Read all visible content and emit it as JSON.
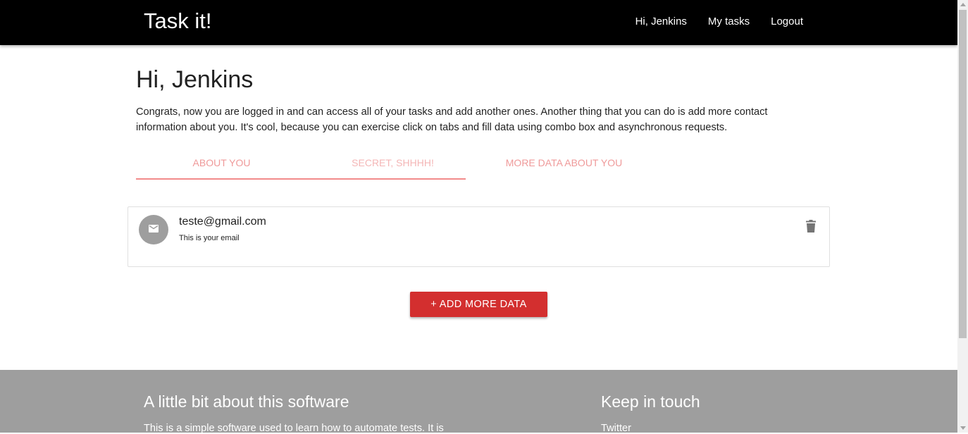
{
  "navbar": {
    "brand": "Task it!",
    "links": [
      {
        "label": "Hi, Jenkins"
      },
      {
        "label": "My tasks"
      },
      {
        "label": "Logout"
      }
    ]
  },
  "main": {
    "greeting": "Hi, Jenkins",
    "intro": "Congrats, now you are logged in and can access all of your tasks and add another ones. Another thing that you can do is add more contact information about you. It's cool, because you can exercise click on tabs and fill data using combo box and asynchronous requests.",
    "tabs": [
      {
        "label": "ABOUT YOU"
      },
      {
        "label": "SECRET, SHHHH!"
      },
      {
        "label": "MORE DATA ABOUT YOU"
      }
    ],
    "contact_card": {
      "icon": "email-icon",
      "value": "teste@gmail.com",
      "caption": "This is your email",
      "delete_icon": "trash-icon"
    },
    "add_button_label": "+ ADD MORE DATA"
  },
  "footer": {
    "about_title": "A little bit about this software",
    "about_text": "This is a simple software used to learn how to automate tests. It is",
    "touch_title": "Keep in touch",
    "touch_link": "Twitter"
  },
  "colors": {
    "navbar": "#000000",
    "accent": "#d32f2f",
    "tab_text": "#ef9a9a",
    "footer": "#9e9e9e"
  }
}
